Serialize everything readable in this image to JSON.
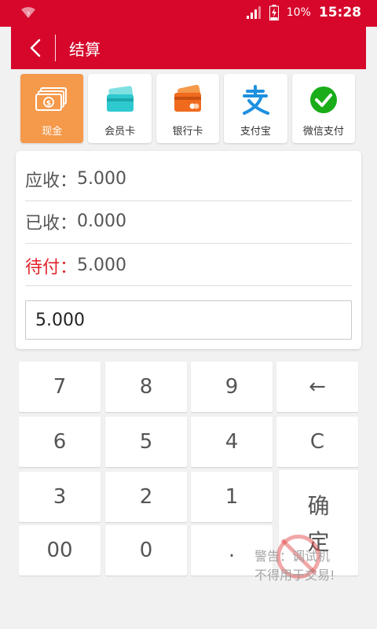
{
  "status_bar": {
    "wifi_icon": "wifi-question-icon",
    "battery_percent": "10%",
    "time": "15:28"
  },
  "app_bar": {
    "title": "结算",
    "back_icon": "back-arrow-icon"
  },
  "payment_methods": [
    {
      "label": "现金",
      "icon": "cash-icon",
      "selected": true
    },
    {
      "label": "会员卡",
      "icon": "member-card-icon",
      "selected": false
    },
    {
      "label": "银行卡",
      "icon": "bank-card-icon",
      "selected": false
    },
    {
      "label": "支付宝",
      "icon": "alipay-icon",
      "selected": false
    },
    {
      "label": "微信支付",
      "icon": "wechat-pay-icon",
      "selected": false
    }
  ],
  "summary": {
    "receivable_label": "应收：",
    "receivable_value": "5.000",
    "received_label": "已收：",
    "received_value": "0.000",
    "due_label": "待付：",
    "due_value": "5.000",
    "input_value": "5.000"
  },
  "keypad": {
    "k7": "7",
    "k8": "8",
    "k9": "9",
    "backspace": "←",
    "k6": "6",
    "k5": "5",
    "k4": "4",
    "clear": "C",
    "k3": "3",
    "k2": "2",
    "k1": "1",
    "k00": "00",
    "k0": "0",
    "dot": ".",
    "confirm_top": "确",
    "confirm_bottom": "定"
  },
  "watermark": {
    "line1": "警告：调试机",
    "line2": "不得用于交易!"
  },
  "colors": {
    "brand_red": "#d6072b",
    "cash_orange": "#f5994b",
    "due_red": "#e0242b"
  }
}
